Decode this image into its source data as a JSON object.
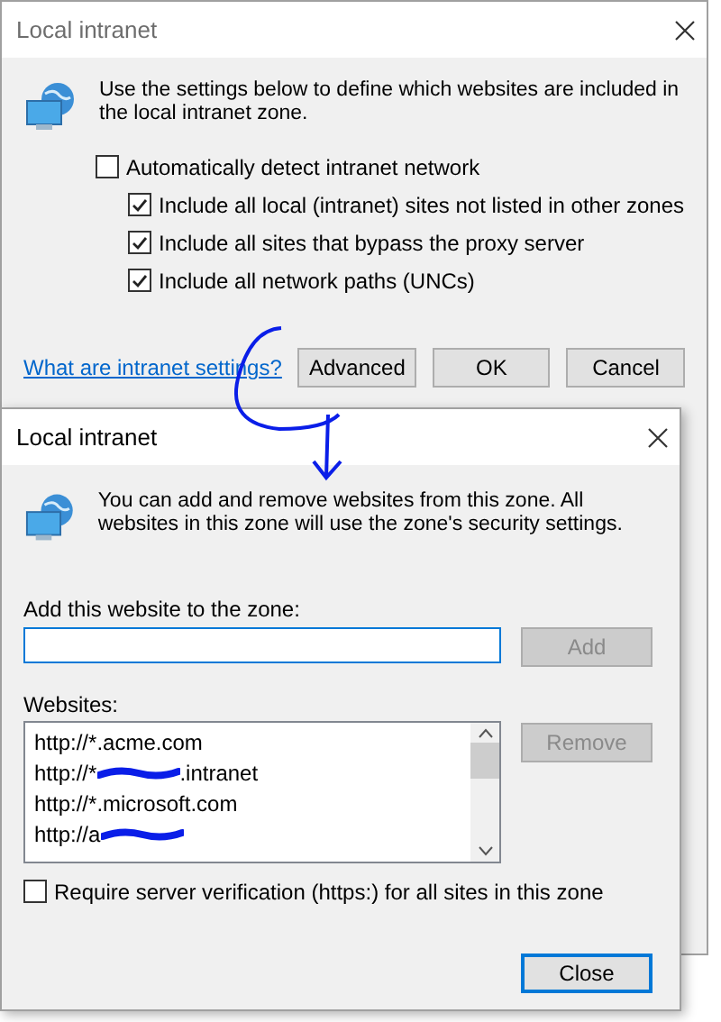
{
  "back_dialog": {
    "title": "Local intranet",
    "description": "Use the settings below to define which websites are included in the local intranet zone.",
    "options": [
      {
        "label": "Automatically detect intranet network",
        "checked": false,
        "children": [
          {
            "label": "Include all local (intranet) sites not listed in other zones",
            "checked": true
          },
          {
            "label": "Include all sites that bypass the proxy server",
            "checked": true
          },
          {
            "label": "Include all network paths (UNCs)",
            "checked": true
          }
        ]
      }
    ],
    "help_link": "What are intranet settings?",
    "buttons": [
      {
        "label": "Advanced",
        "default": false
      },
      {
        "label": "OK",
        "default": false
      },
      {
        "label": "Cancel",
        "default": false
      }
    ]
  },
  "front_dialog": {
    "title": "Local intranet",
    "description": "You can add and remove websites from this zone. All websites in this zone will use the zone's security settings.",
    "add_label": "Add this website to the zone:",
    "add_button": {
      "label": "Add",
      "disabled": true
    },
    "websites_label": "Websites:",
    "websites": [
      {
        "prefix": "http://*.acme.com",
        "redacted": false
      },
      {
        "prefix": "http://*",
        "redacted": true,
        "suffix": ".intranet"
      },
      {
        "prefix": "http://*.microsoft.com",
        "redacted": false
      },
      {
        "prefix": "http://a",
        "redacted": true
      }
    ],
    "remove_button": {
      "label": "Remove",
      "disabled": true
    },
    "require_https": {
      "label": "Require server verification (https:) for all sites in this zone",
      "checked": false
    },
    "close_button": {
      "label": "Close",
      "default": true
    }
  }
}
